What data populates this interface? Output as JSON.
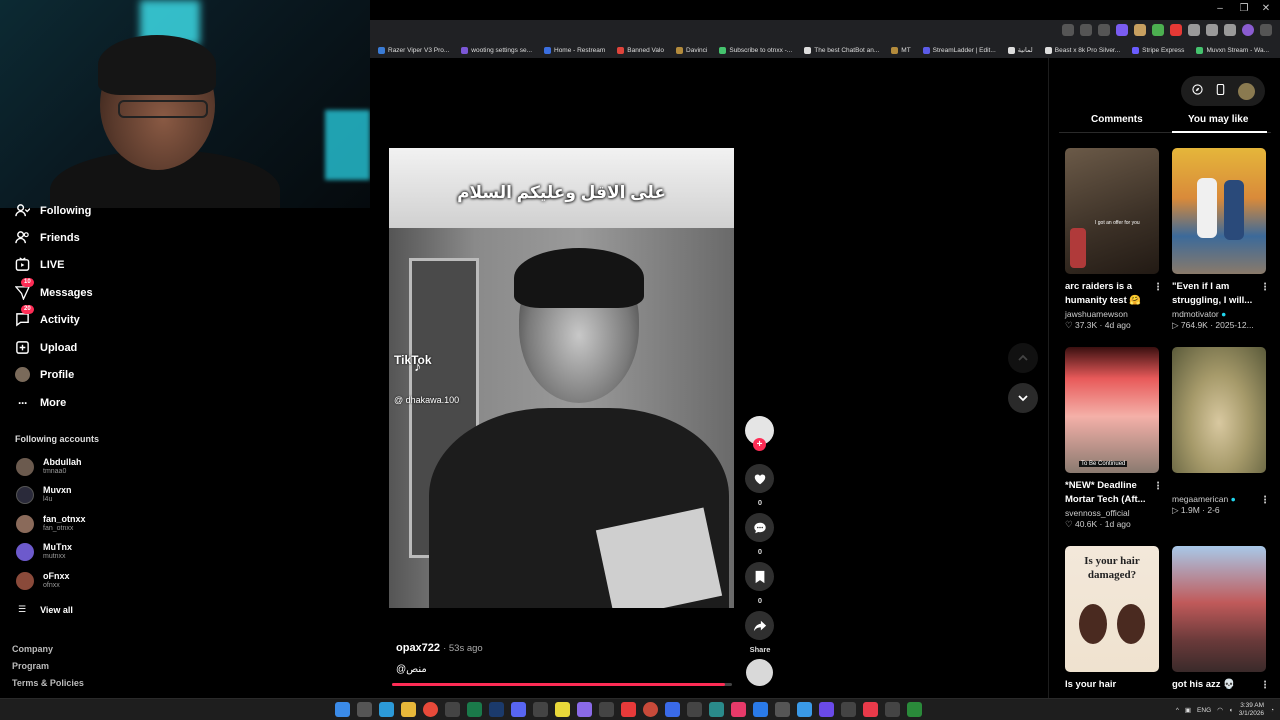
{
  "browser": {
    "bookmarks": [
      {
        "label": "Razer Viper V3 Pro...",
        "color": "#3a7bd5"
      },
      {
        "label": "wooting settings se...",
        "color": "#7b57d6"
      },
      {
        "label": "Home - Restream",
        "color": "#3b6fe0"
      },
      {
        "label": "Banned Valo",
        "color": "#e0443b"
      },
      {
        "label": "Davinci",
        "color": "#b38b3c"
      },
      {
        "label": "Subscribe to otnxx -...",
        "color": "#45c36e"
      },
      {
        "label": "The best ChatBot an...",
        "color": "#dddddd"
      },
      {
        "label": "MT",
        "color": "#b38b3c"
      },
      {
        "label": "StreamLadder | Edit...",
        "color": "#5b5be8"
      },
      {
        "label": "لمانية",
        "color": "#dddddd"
      },
      {
        "label": "Beast x 8k Pro Silver...",
        "color": "#dddddd"
      },
      {
        "label": "Stripe Express",
        "color": "#6a5cff"
      },
      {
        "label": "Muvxn Stream - Wa...",
        "color": "#45c36e"
      }
    ]
  },
  "sidebar": {
    "nav": [
      {
        "label": "Following",
        "icon": "following-icon"
      },
      {
        "label": "Friends",
        "icon": "friends-icon"
      },
      {
        "label": "LIVE",
        "icon": "live-icon"
      },
      {
        "label": "Messages",
        "icon": "messages-icon",
        "badge": "10"
      },
      {
        "label": "Activity",
        "icon": "activity-icon",
        "badge": "20"
      },
      {
        "label": "Upload",
        "icon": "upload-icon"
      },
      {
        "label": "Profile",
        "icon": "profile-icon"
      },
      {
        "label": "More",
        "icon": "more-icon"
      }
    ],
    "following_title": "Following accounts",
    "accounts": [
      {
        "name": "Abdullah",
        "handle": "tmnaa0",
        "color": "#6b5a4e"
      },
      {
        "name": "Muvxn",
        "handle": "l4u",
        "color": "#2a2a3a"
      },
      {
        "name": "fan_otnxx",
        "handle": "fan_otnxx",
        "color": "#8a6a5a"
      },
      {
        "name": "MuTnx",
        "handle": "mutnxx",
        "color": "#6d5acc"
      },
      {
        "name": "oFnxx",
        "handle": "ofnxx",
        "color": "#8a4a3a"
      }
    ],
    "view_all": "View all",
    "footer": [
      "Company",
      "Program",
      "Terms & Policies"
    ]
  },
  "video": {
    "caption": "على الاقل وعليكم السلام",
    "watermark": "TikTok",
    "watermark_handle": "@ dhakawa.100",
    "author": "opax722",
    "time_ago": "· 53s ago",
    "description": "منص@",
    "progress": 0.98,
    "likes": "0",
    "comments": "0",
    "saves": "0",
    "share_label": "Share"
  },
  "right_panel": {
    "tabs": [
      "Comments",
      "You may like"
    ],
    "active_tab": 1,
    "cards": [
      {
        "title": "arc raiders is a humanity test 🤗 ...",
        "author": "jawshuamewson",
        "stats": "♡ 37.3K · 4d ago",
        "thumb_text": "I got an offer for you",
        "bg": "linear-gradient(160deg,#6b5a48,#3b3026 60%,#221a14)"
      },
      {
        "title": "\"Even if I am struggling, I will...",
        "author": "mdmotivator",
        "stats": "▷ 764.9K · 2025-12...",
        "thumb_text": "",
        "bg": "linear-gradient(180deg,#e5b63a 0%,#d98a3a 40%,#3c6a9a 70%,#8a7a6a 100%)"
      },
      {
        "title": "*NEW* Deadline Mortar Tech (Aft...",
        "author": "svennoss_official",
        "stats": "♡ 40.6K · 1d ago",
        "thumb_text": "To Be Continued",
        "bg": "linear-gradient(180deg,#3a1010 0%,#e85a5a 25%,#f4b0a8 55%,#8a7a70 100%)"
      },
      {
        "title": "",
        "author": "megaamerican",
        "stats": "▷ 1.9M · 2-6",
        "thumb_text": "",
        "bg": "radial-gradient(ellipse at 50% 60%,#d8c8a0 0%,#a69a6a 45%,#5a5a3a 100%)"
      },
      {
        "title": "Is your hair damaged?...",
        "author": "",
        "stats": "",
        "thumb_text": "Is your hair damaged?",
        "bg": "linear-gradient(180deg,#f3e8da,#efe2cf)"
      },
      {
        "title": "got his azz 💀",
        "author": "",
        "stats": "",
        "thumb_text": "",
        "bg": "linear-gradient(180deg,#a8c8e8 0%,#c05a5a 45%,#6a3a3a 75%,#3a2a2a 100%)"
      }
    ]
  },
  "taskbar": {
    "lang": "ENG",
    "time": "3:39 AM",
    "date": "3/1/2026"
  },
  "colors": {
    "accent": "#fe2c55",
    "verified": "#20d5ec"
  }
}
